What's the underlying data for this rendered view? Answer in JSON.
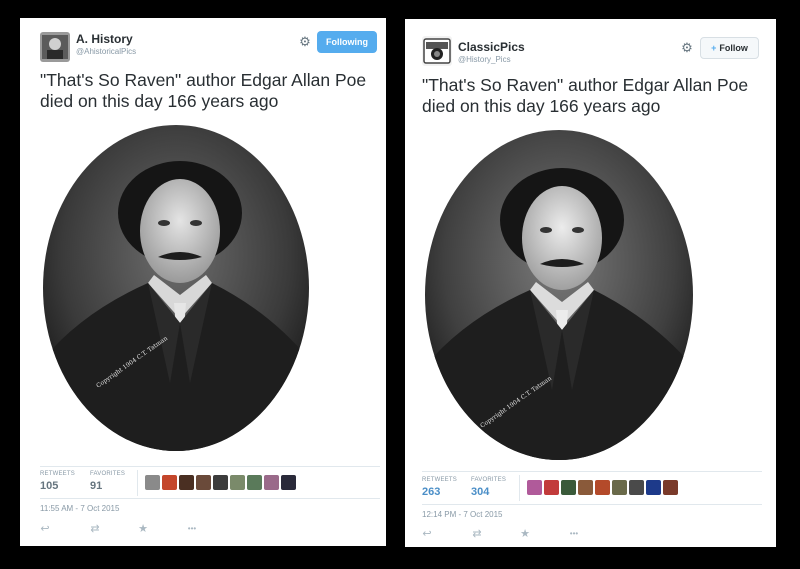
{
  "tweet_a": {
    "name": "A. History",
    "handle": "@AhistoricalPics",
    "follow_label": "Following",
    "text_line1": "\"That's So Raven\" author Edgar Allan Poe",
    "text_line2": "died on this day 166 years ago",
    "retweets_label": "RETWEETS",
    "retweets": "105",
    "favorites_label": "FAVORITES",
    "favorites": "91",
    "timestamp": "11:55 AM - 7 Oct 2015",
    "more": "•••",
    "photo_signature": "Copyright 1904  C.T. Tatman"
  },
  "tweet_b": {
    "name": "ClassicPics",
    "handle": "@History_Pics",
    "follow_label": "Follow",
    "text_line1": "\"That's So Raven\" author Edgar Allan Poe",
    "text_line2": "died on this day 166 years ago",
    "retweets_label": "RETWEETS",
    "retweets": "263",
    "favorites_label": "FAVORITES",
    "favorites": "304",
    "timestamp": "12:14 PM - 7 Oct 2015",
    "more": "•••",
    "photo_signature": "Copyright 1904  C.T. Tatman"
  },
  "icons": {
    "gear": "gear-icon",
    "reply": "reply-icon",
    "retweet": "retweet-icon",
    "favorite": "star-icon",
    "more": "more-icon"
  },
  "colors": {
    "follow_blue": "#55acee",
    "count_blue": "#4a8ec7"
  }
}
